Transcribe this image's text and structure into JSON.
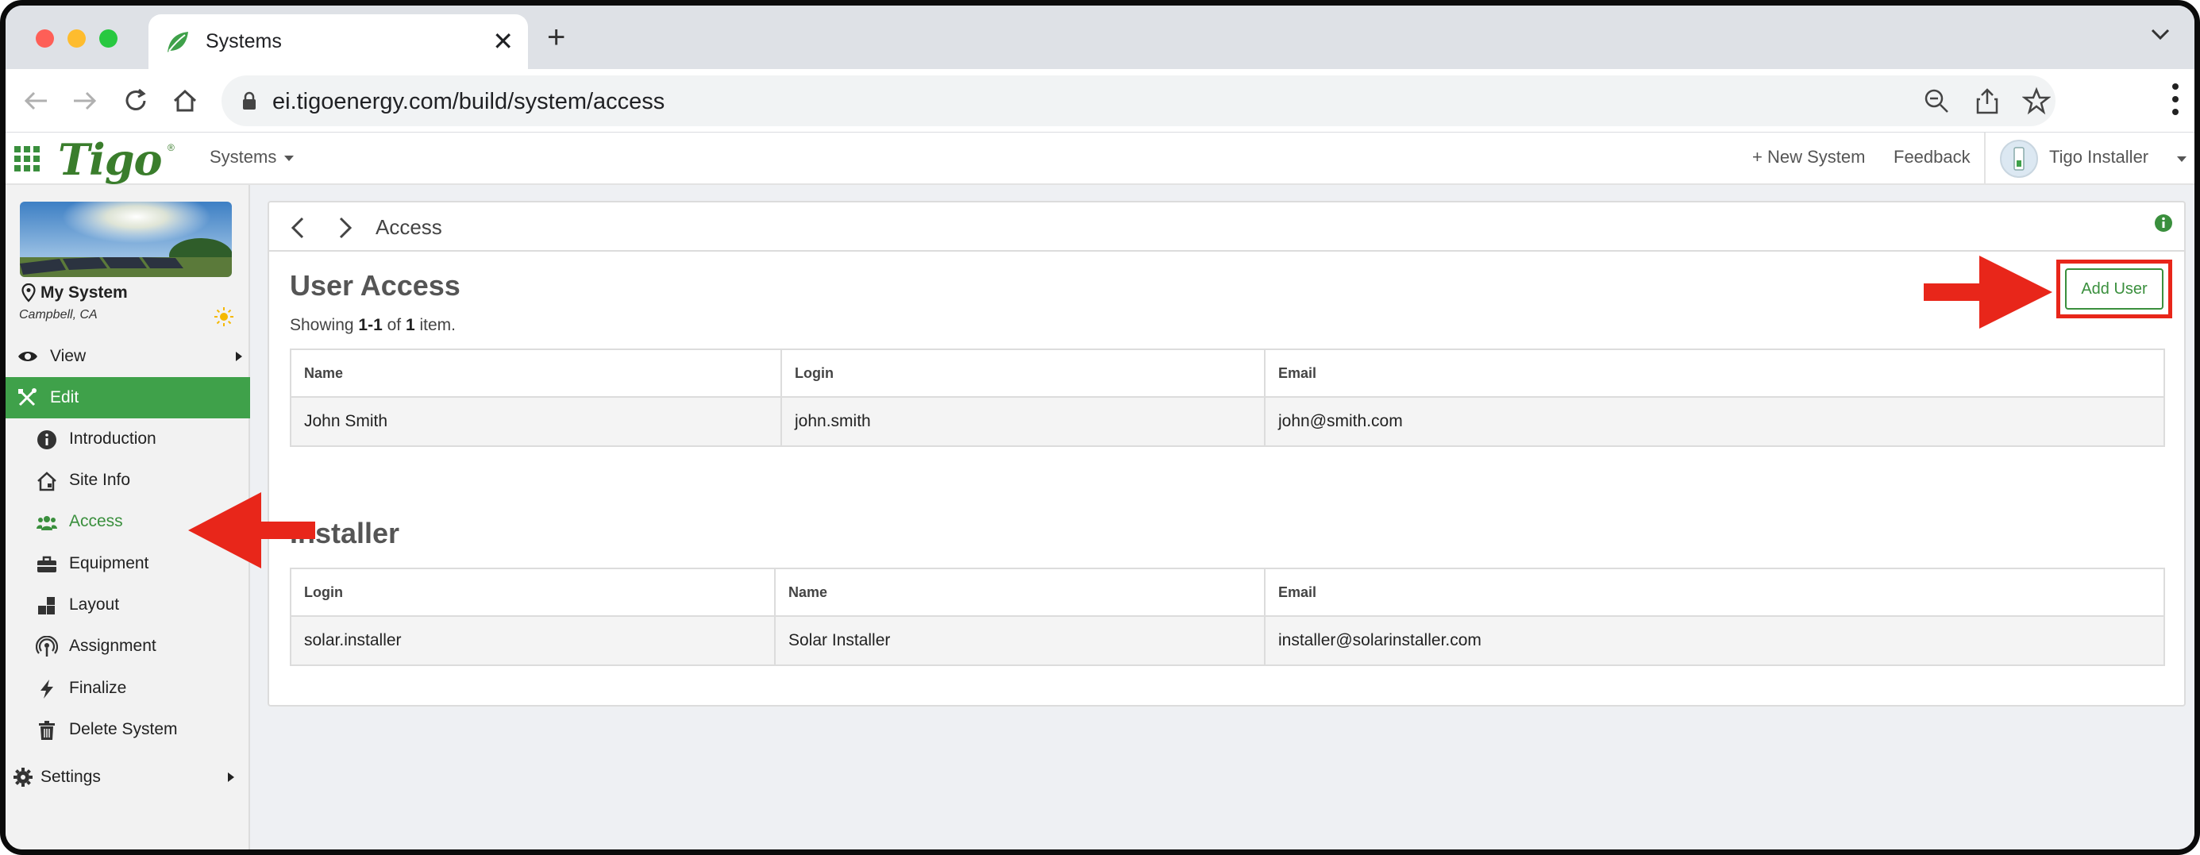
{
  "browser": {
    "tab_title": "Systems",
    "url": "ei.tigoenergy.com/build/system/access"
  },
  "header": {
    "logo": "Tigo",
    "systems_menu": "Systems",
    "new_system": "+ New System",
    "feedback": "Feedback",
    "user_name": "Tigo Installer"
  },
  "sidebar": {
    "system_name": "My System",
    "system_location": "Campbell, CA",
    "view_label": "View",
    "edit_label": "Edit",
    "items": [
      {
        "label": "Introduction",
        "icon": "info-icon"
      },
      {
        "label": "Site Info",
        "icon": "house-icon"
      },
      {
        "label": "Access",
        "icon": "users-icon"
      },
      {
        "label": "Equipment",
        "icon": "toolbox-icon"
      },
      {
        "label": "Layout",
        "icon": "layout-icon"
      },
      {
        "label": "Assignment",
        "icon": "antenna-icon"
      },
      {
        "label": "Finalize",
        "icon": "bolt-icon"
      },
      {
        "label": "Delete System",
        "icon": "trash-icon"
      }
    ],
    "settings_label": "Settings"
  },
  "main": {
    "breadcrumb_title": "Access",
    "user_access": {
      "title": "User Access",
      "showing_prefix": "Showing ",
      "showing_range": "1-1",
      "showing_of": " of ",
      "showing_total": "1",
      "showing_suffix": " item.",
      "add_user_label": "Add User",
      "columns": [
        "Name",
        "Login",
        "Email"
      ],
      "rows": [
        {
          "name": "John Smith",
          "login": "john.smith",
          "email": "john@smith.com"
        }
      ]
    },
    "installer": {
      "title": "Installer",
      "columns": [
        "Login",
        "Name",
        "Email"
      ],
      "rows": [
        {
          "login": "solar.installer",
          "name": "Solar Installer",
          "email": "installer@solarinstaller.com"
        }
      ]
    }
  },
  "colors": {
    "brand_green": "#3a8f3d",
    "active_nav": "#3fa14a",
    "annotation_red": "#e8261a"
  }
}
